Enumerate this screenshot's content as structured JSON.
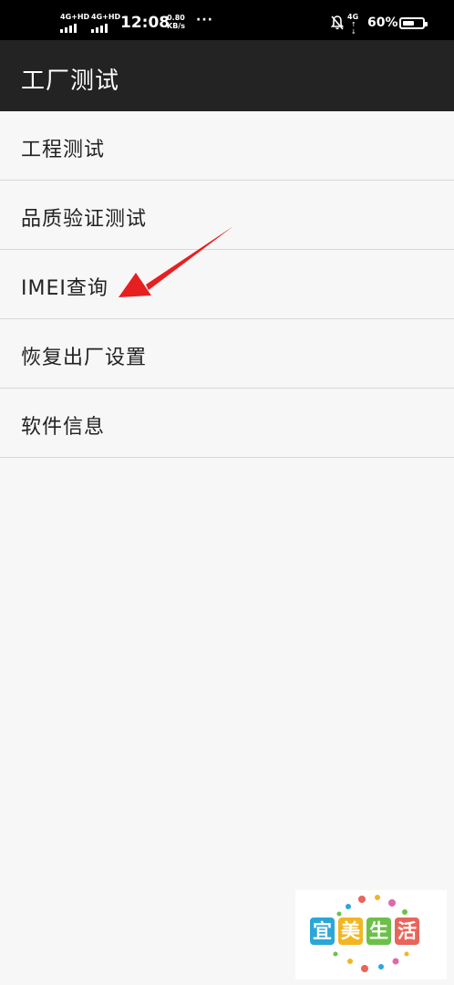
{
  "status_bar": {
    "sim1_network": "4G+HD",
    "sim2_network": "4G+HD",
    "time": "12:08",
    "speed_value": "0.80",
    "speed_unit": "KB/s",
    "overflow": "···",
    "data_network": "4G",
    "battery_percent": "60%",
    "battery_level": 0.6
  },
  "app_bar": {
    "title": "工厂测试"
  },
  "menu": {
    "items": [
      {
        "label": "工程测试"
      },
      {
        "label": "品质验证测试"
      },
      {
        "label": "IMEI查询"
      },
      {
        "label": "恢复出厂设置"
      },
      {
        "label": "软件信息"
      }
    ]
  },
  "watermark": {
    "chars": [
      "宜",
      "美",
      "生",
      "活"
    ],
    "colors": [
      "#2aa7d8",
      "#f2b623",
      "#6cc04a",
      "#e9645a"
    ]
  },
  "colors": {
    "app_bar_bg": "#232323",
    "page_bg": "#f7f7f7",
    "annotation_arrow": "#e62020"
  }
}
